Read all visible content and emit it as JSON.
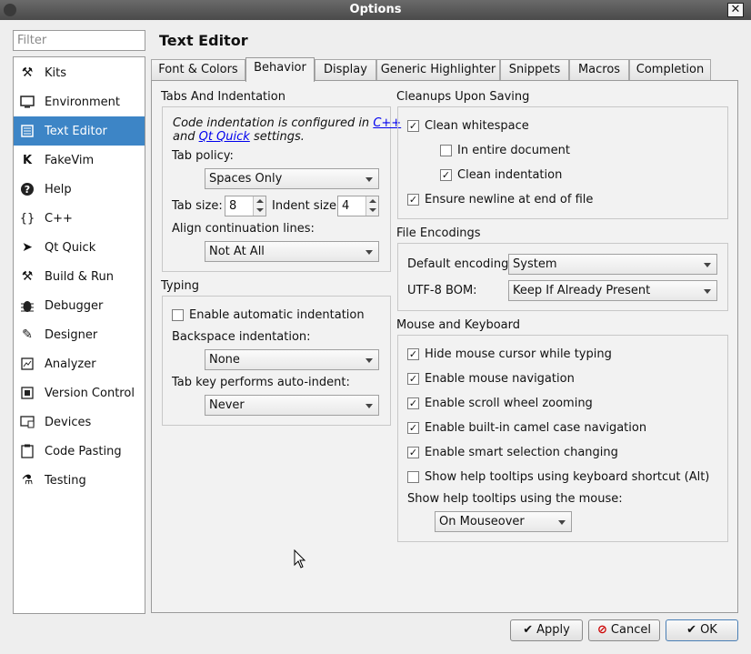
{
  "window": {
    "title": "Options"
  },
  "filter": {
    "placeholder": "Filter"
  },
  "categories": [
    {
      "label": "Kits",
      "icon": "kits-icon",
      "glyph": "⚒"
    },
    {
      "label": "Environment",
      "icon": "monitor-icon",
      "glyph": "🖵"
    },
    {
      "label": "Text Editor",
      "icon": "text-editor-icon",
      "glyph": "☰"
    },
    {
      "label": "FakeVim",
      "icon": "fakevim-icon",
      "glyph": "K"
    },
    {
      "label": "Help",
      "icon": "help-icon",
      "glyph": "?"
    },
    {
      "label": "C++",
      "icon": "braces-icon",
      "glyph": "{}"
    },
    {
      "label": "Qt Quick",
      "icon": "qt-quick-icon",
      "glyph": "➤"
    },
    {
      "label": "Build & Run",
      "icon": "hammer-icon",
      "glyph": "⚒"
    },
    {
      "label": "Debugger",
      "icon": "bug-icon",
      "glyph": "✱"
    },
    {
      "label": "Designer",
      "icon": "pencil-icon",
      "glyph": "✎"
    },
    {
      "label": "Analyzer",
      "icon": "analyzer-icon",
      "glyph": "▤"
    },
    {
      "label": "Version Control",
      "icon": "version-control-icon",
      "glyph": "▢"
    },
    {
      "label": "Devices",
      "icon": "devices-icon",
      "glyph": "▭"
    },
    {
      "label": "Code Pasting",
      "icon": "clipboard-icon",
      "glyph": "▤"
    },
    {
      "label": "Testing",
      "icon": "testing-icon",
      "glyph": "⚗"
    }
  ],
  "page_title": "Text Editor",
  "tabs": [
    {
      "label": "Font & Colors"
    },
    {
      "label": "Behavior"
    },
    {
      "label": "Display"
    },
    {
      "label": "Generic Highlighter"
    },
    {
      "label": "Snippets"
    },
    {
      "label": "Macros"
    },
    {
      "label": "Completion"
    }
  ],
  "tabs_indent": {
    "title": "Tabs And Indentation",
    "note_part1": "Code indentation is configured in ",
    "note_link1": "C++",
    "note_part2": "and ",
    "note_link2": "Qt Quick",
    "note_part3": " settings.",
    "tab_policy_label": "Tab policy:",
    "tab_policy_value": "Spaces Only",
    "tab_size_label": "Tab size:",
    "tab_size_value": "8",
    "indent_size_label": "Indent size:",
    "indent_size_value": "4",
    "align_label": "Align continuation lines:",
    "align_value": "Not At All"
  },
  "typing": {
    "title": "Typing",
    "auto_indent_label": "Enable automatic indentation",
    "auto_indent_checked": false,
    "backspace_label": "Backspace indentation:",
    "backspace_value": "None",
    "tabkey_label": "Tab key performs auto-indent:",
    "tabkey_value": "Never"
  },
  "cleanups": {
    "title": "Cleanups Upon Saving",
    "clean_ws_label": "Clean whitespace",
    "clean_ws_checked": true,
    "entire_doc_label": "In entire document",
    "entire_doc_checked": false,
    "clean_indent_label": "Clean indentation",
    "clean_indent_checked": true,
    "newline_label": "Ensure newline at end of file",
    "newline_checked": true
  },
  "encodings": {
    "title": "File Encodings",
    "default_label": "Default encoding:",
    "default_value": "System",
    "bom_label": "UTF-8 BOM:",
    "bom_value": "Keep If Already Present"
  },
  "mouse_keyboard": {
    "title": "Mouse and Keyboard",
    "items": [
      {
        "label": "Hide mouse cursor while typing",
        "checked": true
      },
      {
        "label": "Enable mouse navigation",
        "checked": true
      },
      {
        "label": "Enable scroll wheel zooming",
        "checked": true
      },
      {
        "label": "Enable built-in camel case navigation",
        "checked": true
      },
      {
        "label": "Enable smart selection changing",
        "checked": true
      },
      {
        "label": "Show help tooltips using keyboard shortcut (Alt)",
        "checked": false
      }
    ],
    "tooltips_mouse_label": "Show help tooltips using the mouse:",
    "tooltips_mouse_value": "On Mouseover"
  },
  "buttons": {
    "apply": "Apply",
    "cancel": "Cancel",
    "ok": "OK"
  }
}
